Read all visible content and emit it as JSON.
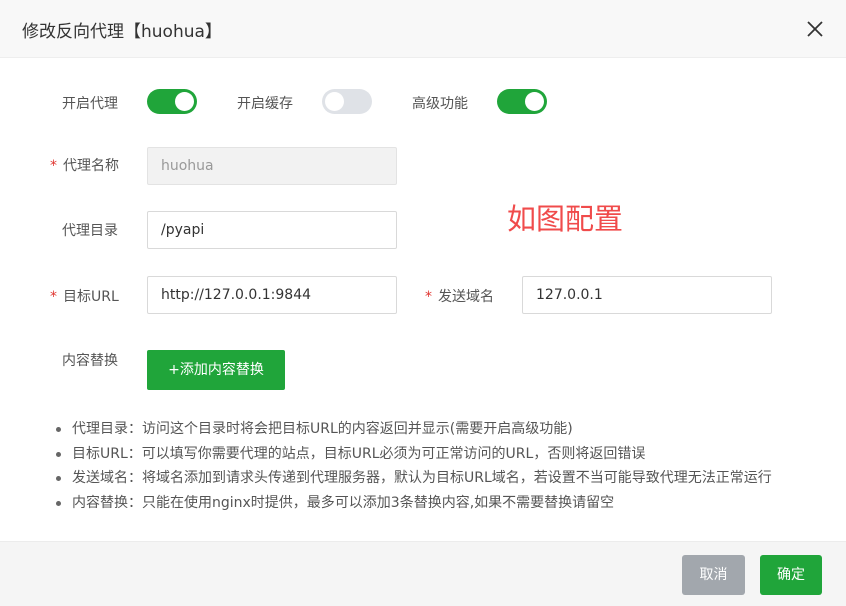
{
  "dialog": {
    "title": "修改反向代理【huohua】",
    "close_icon": "close-icon"
  },
  "toggles": [
    {
      "label": "开启代理",
      "on": true
    },
    {
      "label": "开启缓存",
      "on": false
    },
    {
      "label": "高级功能",
      "on": true
    }
  ],
  "fields": {
    "proxy_name": {
      "label": "代理名称",
      "value": "huohua",
      "required": true,
      "disabled": true
    },
    "proxy_dir": {
      "label": "代理目录",
      "value": "/pyapi"
    },
    "target_url": {
      "label": "目标URL",
      "value": "http://127.0.0.1:9844",
      "required": true
    },
    "send_domain": {
      "label": "发送域名",
      "value": "127.0.0.1",
      "required": true
    },
    "content_replace": {
      "label": "内容替换",
      "button_label": "+添加内容替换"
    }
  },
  "required_mark": "*",
  "annotation": "如图配置",
  "tips": [
    "代理目录：访问这个目录时将会把目标URL的内容返回并显示(需要开启高级功能)",
    "目标URL：可以填写你需要代理的站点，目标URL必须为可正常访问的URL，否则将返回错误",
    "发送域名：将域名添加到请求头传递到代理服务器，默认为目标URL域名，若设置不当可能导致代理无法正常运行",
    "内容替换：只能在使用nginx时提供，最多可以添加3条替换内容,如果不需要替换请留空"
  ],
  "footer": {
    "cancel_label": "取消",
    "confirm_label": "确定"
  },
  "colors": {
    "accent": "#20a53a",
    "required": "#e0342f",
    "annotation": "#f04b4b",
    "cancel": "#a2a7ad"
  }
}
